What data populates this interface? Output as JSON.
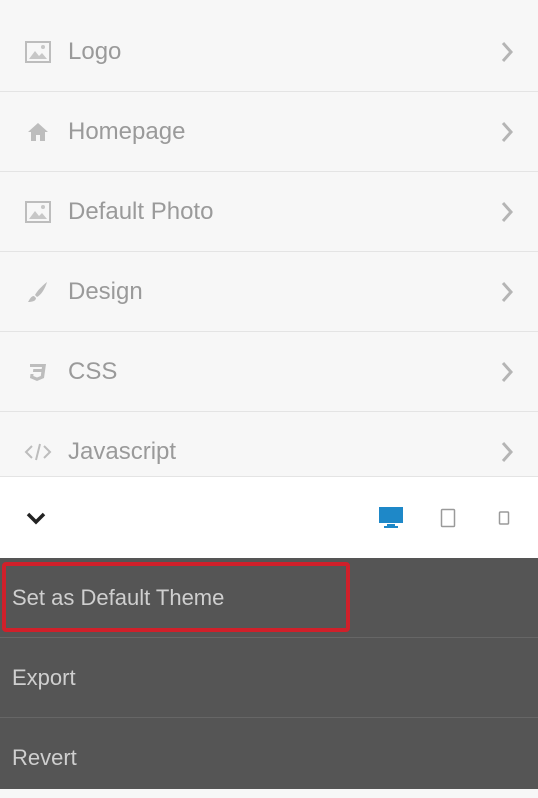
{
  "menu": {
    "items": [
      {
        "label": "Logo",
        "icon": "image-icon"
      },
      {
        "label": "Homepage",
        "icon": "home-icon"
      },
      {
        "label": "Default Photo",
        "icon": "image-icon"
      },
      {
        "label": "Design",
        "icon": "brush-icon"
      },
      {
        "label": "CSS",
        "icon": "css3-icon"
      },
      {
        "label": "Javascript",
        "icon": "code-icon"
      }
    ]
  },
  "toolbar": {
    "collapse_icon": "chevron-down-icon",
    "devices": [
      {
        "icon": "desktop-icon",
        "active": true
      },
      {
        "icon": "tablet-icon",
        "active": false
      },
      {
        "icon": "phone-icon",
        "active": false
      }
    ],
    "active_color": "#1e88c8"
  },
  "actions": [
    {
      "label": "Set as Default Theme",
      "highlighted": true
    },
    {
      "label": "Export",
      "highlighted": false
    },
    {
      "label": "Revert",
      "highlighted": false
    }
  ],
  "colors": {
    "highlight_border": "#d0202a",
    "actions_bg": "#555555"
  }
}
